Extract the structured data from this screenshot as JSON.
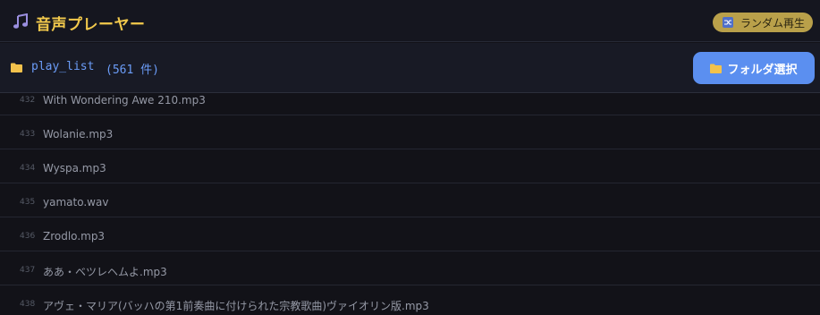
{
  "header": {
    "title": "音声プレーヤー",
    "shuffle_label": "ランダム再生",
    "title_color": "#f2c94c"
  },
  "toolbar": {
    "playlist_name": "play_list",
    "track_count": "(561 件)",
    "folder_button_label": "フォルダ選択"
  },
  "tracks": [
    {
      "num": "432",
      "name": "With Wondering Awe 210.mp3"
    },
    {
      "num": "433",
      "name": "Wolanie.mp3"
    },
    {
      "num": "434",
      "name": "Wyspa.mp3"
    },
    {
      "num": "435",
      "name": "yamato.wav"
    },
    {
      "num": "436",
      "name": "Zrodlo.mp3"
    },
    {
      "num": "437",
      "name": "ああ・ベツレヘムよ.mp3"
    },
    {
      "num": "438",
      "name": "アヴェ・マリア(バッハの第1前奏曲に付けられた宗教歌曲)ヴァイオリン版.mp3"
    }
  ],
  "icons": {
    "app": "music-note-icon",
    "shuffle": "shuffle-icon",
    "folder": "folder-icon"
  }
}
